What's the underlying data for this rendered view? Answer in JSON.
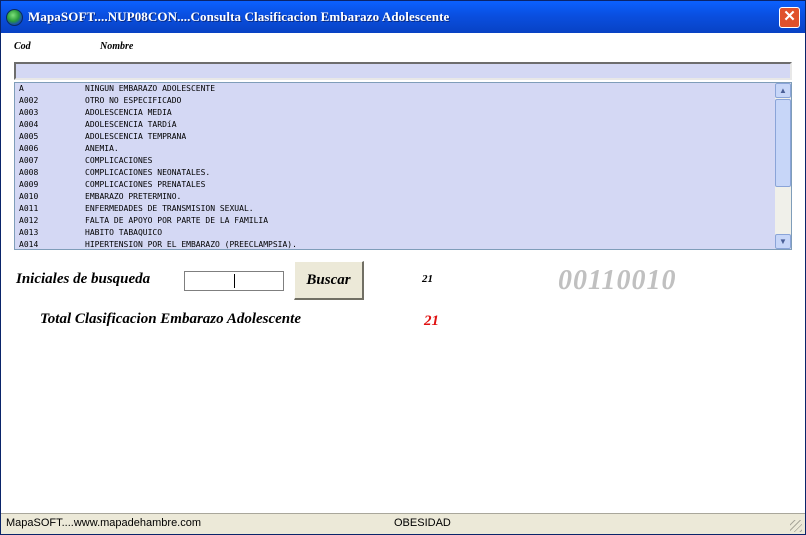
{
  "window": {
    "title": "MapaSOFT....NUP08CON....Consulta  Clasificacion Embarazo Adolescente",
    "close_symbol": "✕",
    "icon": "globe-icon"
  },
  "columns": {
    "code": "Cod",
    "name": "Nombre"
  },
  "list": {
    "rows": [
      {
        "code": "A",
        "name": "NINGUN EMBARAZO ADOLESCENTE"
      },
      {
        "code": "A002",
        "name": "OTRO NO ESPECIFICADO"
      },
      {
        "code": "A003",
        "name": "ADOLESCENCIA MEDIA"
      },
      {
        "code": "A004",
        "name": "ADOLESCENCIA TARDíA"
      },
      {
        "code": "A005",
        "name": "ADOLESCENCIA TEMPRANA"
      },
      {
        "code": "A006",
        "name": "ANEMIA."
      },
      {
        "code": "A007",
        "name": "COMPLICACIONES"
      },
      {
        "code": "A008",
        "name": "COMPLICACIONES NEONATALES."
      },
      {
        "code": "A009",
        "name": "COMPLICACIONES PRENATALES"
      },
      {
        "code": "A010",
        "name": "EMBARAZO PRETERMINO."
      },
      {
        "code": "A011",
        "name": "ENFERMEDADES DE TRANSMISION SEXUAL."
      },
      {
        "code": "A012",
        "name": "FALTA DE APOYO POR PARTE DE LA FAMILIA"
      },
      {
        "code": "A013",
        "name": "HABITO TABAQUICO"
      },
      {
        "code": "A014",
        "name": "HIPERTENSION POR EL EMBARAZO (PREECLAMPSIA)."
      }
    ]
  },
  "search": {
    "label": "Iniciales de busqueda",
    "value": "",
    "button_label": "Buscar",
    "result_count": "21"
  },
  "code_display": "00110010",
  "total": {
    "label": "Total  Clasificacion Embarazo Adolescente",
    "value": "21"
  },
  "status": {
    "left": "MapaSOFT....www.mapadehambre.com",
    "middle": "OBESIDAD"
  },
  "colors": {
    "list_bg": "#d4d8f4",
    "total_value": "#e01010",
    "code_display": "#c0c0c0"
  }
}
